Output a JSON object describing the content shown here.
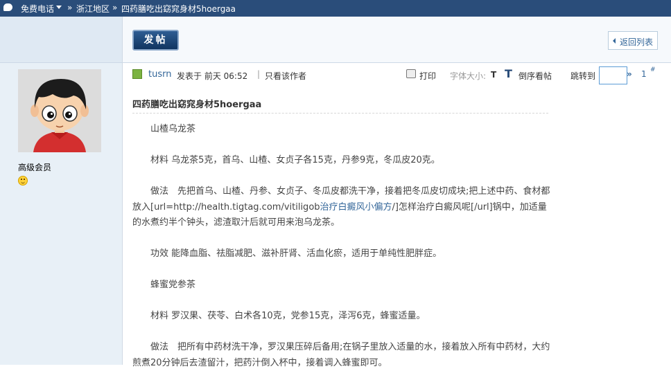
{
  "topbar": {
    "phone_label": "免费电话",
    "sep": "»",
    "region": "浙江地区",
    "page_title": "四药膳吃出窈窕身材5hoergaa"
  },
  "toolbar": {
    "post_button": "发帖",
    "back_button": "返回列表"
  },
  "user": {
    "rank": "高级会员"
  },
  "post_meta": {
    "author": "tusrn",
    "time": "发表于 前天 06:52",
    "separator": "|",
    "only_author": "只看该作者",
    "print": "打印",
    "font_size_label": "字体大小:",
    "font_small": "T",
    "font_large": "T",
    "reverse": "倒序看帖",
    "goto_label": "跳转到",
    "goto_arrow": "»",
    "floor": "1",
    "floor_mark": "#"
  },
  "thread": {
    "title": "四药膳吃出窈窕身材5hoergaa"
  },
  "content": {
    "p1": "山楂乌龙茶",
    "p2": "材料 乌龙茶5克，首乌、山楂、女贞子各15克，丹参9克，冬瓜皮20克。",
    "p3_a": "做法　先把首乌、山楂、丹参、女贞子、冬瓜皮都洗干净，接着把冬瓜皮切成块;把上述中药、食材都放入[url=http://health.tigtag.com/vitiligob",
    "p3_link": "治疗白癜风小偏方",
    "p3_b": "/]怎样治疗白癜风呢[/url]锅中，加适量的水煮约半个钟头，滤渣取汁后就可用来泡乌龙茶。",
    "p4": "功效 能降血脂、祛脂减肥、滋补肝肾、活血化瘀，适用于单纯性肥胖症。",
    "p5": "蜂蜜党参茶",
    "p6": "材料 罗汉果、茯苓、白术各10克，党参15克，泽泻6克，蜂蜜适量。",
    "p7": "做法　把所有中药材洗干净，罗汉果压碎后备用;在锅子里放入适量的水，接着放入所有中药材，大约煎煮20分钟后去渣留汁，把药汁倒入杯中，接着调入蜂蜜即可。"
  }
}
